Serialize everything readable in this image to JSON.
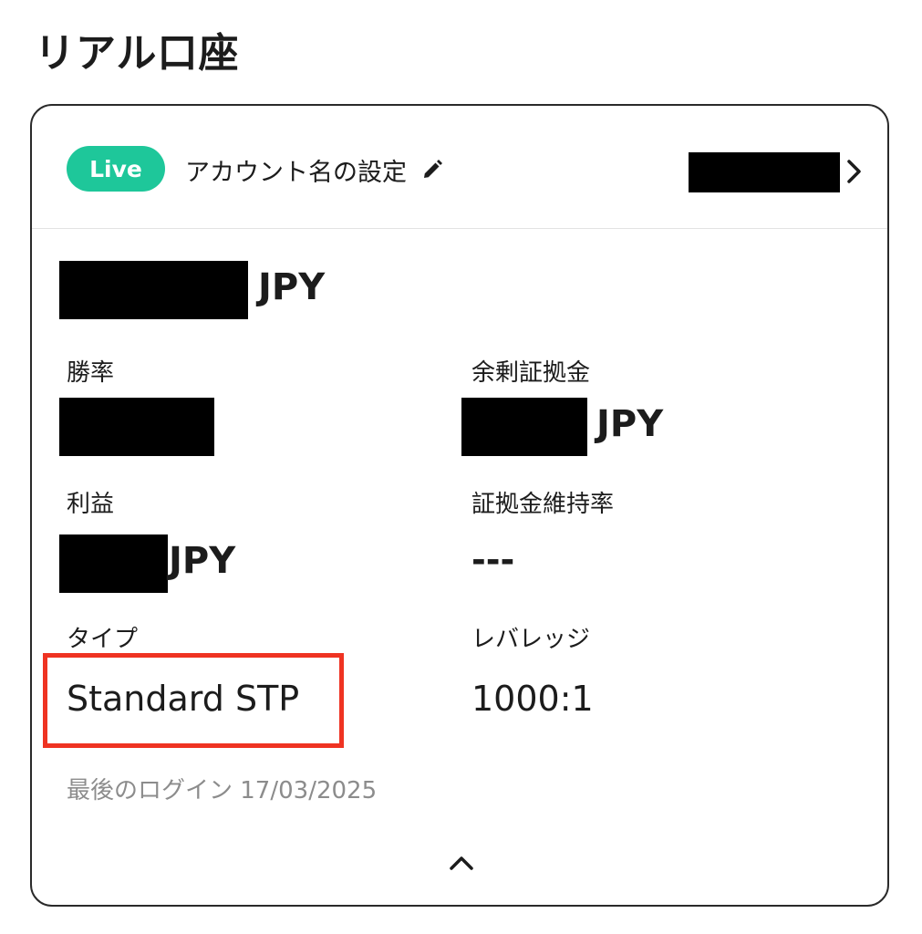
{
  "section": {
    "title": "リアル口座"
  },
  "account": {
    "badge": "Live",
    "name_button_label": "アカウント名の設定",
    "balance_currency": "JPY"
  },
  "stats": {
    "win_rate_label": "勝率",
    "free_margin_label": "余剰証拠金",
    "free_margin_currency": "JPY",
    "profit_label": "利益",
    "profit_currency": "JPY",
    "margin_level_label": "証拠金維持率",
    "margin_level_value": "---",
    "type_label": "タイプ",
    "type_value": "Standard STP",
    "leverage_label": "レバレッジ",
    "leverage_value": "1000:1"
  },
  "footer": {
    "last_login": "最後のログイン 17/03/2025"
  },
  "colors": {
    "live_badge": "#1ec79a",
    "highlight_box": "#ef3322",
    "redaction": "#000000",
    "muted_text": "#8c8c8c"
  },
  "icons": {
    "edit": "pencil-icon",
    "open": "chevron-right-icon",
    "collapse": "chevron-up-icon"
  }
}
